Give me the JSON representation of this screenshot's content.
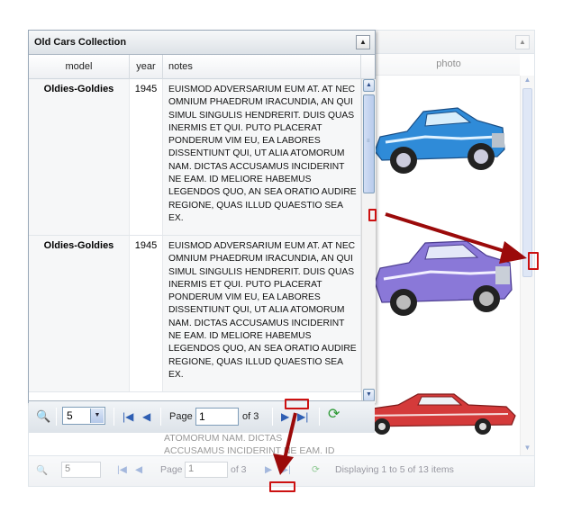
{
  "grid": {
    "title": "Old Cars Collection",
    "columns": {
      "model": "model",
      "year": "year",
      "notes": "notes"
    },
    "rows": [
      {
        "model": "Oldies-Goldies",
        "year": "1945",
        "notes": "EUISMOD ADVERSARIUM EUM AT. AT NEC OMNIUM PHAEDRUM IRACUNDIA, AN QUI SIMUL SINGULIS HENDRERIT. DUIS QUAS INERMIS ET QUI. PUTO PLACERAT PONDERUM VIM EU, EA LABORES DISSENTIUNT QUI, UT ALIA ATOMORUM NAM. DICTAS ACCUSAMUS INCIDERINT NE EAM. ID MELIORE HABEMUS LEGENDOS QUO, AN SEA ORATIO AUDIRE REGIONE, QUAS ILLUD QUAESTIO SEA EX."
      },
      {
        "model": "Oldies-Goldies",
        "year": "1945",
        "notes": "EUISMOD ADVERSARIUM EUM AT. AT NEC OMNIUM PHAEDRUM IRACUNDIA, AN QUI SIMUL SINGULIS HENDRERIT. DUIS QUAS INERMIS ET QUI. PUTO PLACERAT PONDERUM VIM EU, EA LABORES DISSENTIUNT QUI, UT ALIA ATOMORUM NAM. DICTAS ACCUSAMUS INCIDERINT NE EAM. ID MELIORE HABEMUS LEGENDOS QUO, AN SEA ORATIO AUDIRE REGIONE, QUAS ILLUD QUAESTIO SEA EX."
      }
    ],
    "pager": {
      "page_size": "5",
      "page_label": "Page",
      "page_value": "1",
      "of_label": "of 3"
    }
  },
  "background_grid": {
    "photo_header": "photo",
    "partial_notes": "PLACERAT PONDERUM VIM EU, EA LABORES DISSENTIUNT QUI, UT ALIA ATOMORUM NAM. DICTAS ACCUSAMUS INCIDERINT NE EAM. ID MELIORE",
    "pager": {
      "page_size": "5",
      "page_label": "Page",
      "page_value": "1",
      "of_label": "of 3",
      "status": "Displaying 1 to 5 of 13 items"
    }
  },
  "icons": {
    "search": "magnifier-icon",
    "first": "first-page-icon",
    "prev": "prev-page-icon",
    "next": "next-page-icon",
    "last": "last-page-icon",
    "refresh": "refresh-icon"
  },
  "colors": {
    "annotation": "#cc1111",
    "arrow": "#990000",
    "scroll_thumb": "#c6d4ef"
  }
}
